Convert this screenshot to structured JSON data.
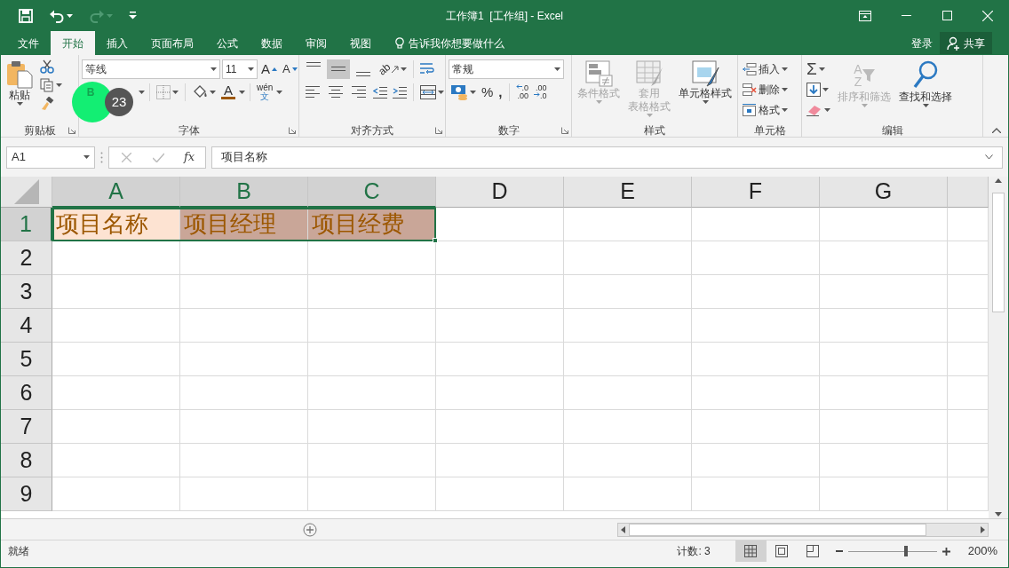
{
  "window": {
    "title": "工作簿1  [工作组] - Excel"
  },
  "quick_access": [
    {
      "kind": "save",
      "disabled": false
    },
    {
      "kind": "undo",
      "disabled": false
    },
    {
      "kind": "redo",
      "disabled": true
    },
    {
      "kind": "customize",
      "disabled": false
    }
  ],
  "tabs": [
    {
      "label": "文件",
      "selected": false
    },
    {
      "label": "开始",
      "selected": true
    },
    {
      "label": "插入",
      "selected": false
    },
    {
      "label": "页面布局",
      "selected": false
    },
    {
      "label": "公式",
      "selected": false
    },
    {
      "label": "数据",
      "selected": false
    },
    {
      "label": "审阅",
      "selected": false
    },
    {
      "label": "视图",
      "selected": false
    }
  ],
  "tell_me": {
    "placeholder": "告诉我你想要做什么"
  },
  "account": {
    "sign_in": "登录",
    "share": "共享"
  },
  "clipboard": {
    "label": "剪贴板",
    "paste": "粘贴"
  },
  "font": {
    "label": "字体",
    "name": "等线",
    "pt": "11",
    "grow": "A",
    "shrink": "A",
    "bold": "B",
    "font_color": "A",
    "phonetic_top": "wén",
    "phonetic_bottom": "文"
  },
  "alignment": {
    "label": "对齐方式",
    "orientation": "ab",
    "vertical": [
      {
        "kind": "top",
        "selected": false
      },
      {
        "kind": "middle",
        "selected": true
      },
      {
        "kind": "bottom",
        "selected": false
      }
    ]
  },
  "number": {
    "label": "数字",
    "format": "常规",
    "percent": "%",
    "comma": ",",
    "decimals": [
      {
        "kind": "increase",
        "upper_text": ".0",
        "lower_text": ".00"
      },
      {
        "kind": "decrease",
        "upper_text": ".00",
        "lower_text": ".0"
      }
    ]
  },
  "styles": {
    "label": "样式",
    "buttons": [
      {
        "kind": "conditional",
        "lines": [
          "条件格式"
        ],
        "disabled": true
      },
      {
        "kind": "table",
        "lines": [
          "套用",
          "表格格式"
        ],
        "disabled": true
      },
      {
        "kind": "cell",
        "lines": [
          "单元格样式"
        ],
        "disabled": false
      }
    ]
  },
  "cells": {
    "label": "单元格",
    "buttons": [
      {
        "kind": "insert",
        "label": "插入"
      },
      {
        "kind": "delete",
        "label": "删除"
      },
      {
        "kind": "format",
        "label": "格式"
      }
    ]
  },
  "editing": {
    "label": "编辑",
    "autosum": "Σ",
    "sort_letters": [
      "A",
      "Z"
    ],
    "buttons": [
      {
        "kind": "sort",
        "label": "排序和筛选",
        "disabled": true
      },
      {
        "kind": "find",
        "label": "查找和选择",
        "disabled": false
      }
    ]
  },
  "formula_bar": {
    "name_box": "A1",
    "function_label": "fx",
    "formula": "项目名称"
  },
  "sheet": {
    "columns": [
      {
        "label": "A",
        "selected": true
      },
      {
        "label": "B",
        "selected": true
      },
      {
        "label": "C",
        "selected": true
      },
      {
        "label": "D",
        "selected": false
      },
      {
        "label": "E",
        "selected": false
      },
      {
        "label": "F",
        "selected": false
      },
      {
        "label": "G",
        "selected": false
      }
    ],
    "rows": [
      {
        "label": "1",
        "selected": true,
        "cells": [
          {
            "text": "项目名称",
            "color": "#fde3d2"
          },
          {
            "text": "项目经理",
            "color": "#c9a698"
          },
          {
            "text": "项目经费",
            "color": "#c9a698"
          }
        ]
      },
      {
        "label": "2",
        "selected": false
      },
      {
        "label": "3",
        "selected": false
      },
      {
        "label": "4",
        "selected": false
      },
      {
        "label": "5",
        "selected": false
      },
      {
        "label": "6",
        "selected": false
      },
      {
        "label": "7",
        "selected": false
      },
      {
        "label": "8",
        "selected": false
      },
      {
        "label": "9",
        "selected": false
      }
    ]
  },
  "tutorial": {
    "step": "23"
  },
  "status_bar": {
    "status": "就绪",
    "count": "计数: 3",
    "views": [
      {
        "kind": "normal",
        "selected": true
      },
      {
        "kind": "page_layout",
        "selected": false
      },
      {
        "kind": "page_break",
        "selected": false
      }
    ],
    "zoom_slider": {
      "level": 0.65
    },
    "zoom": "200%"
  }
}
